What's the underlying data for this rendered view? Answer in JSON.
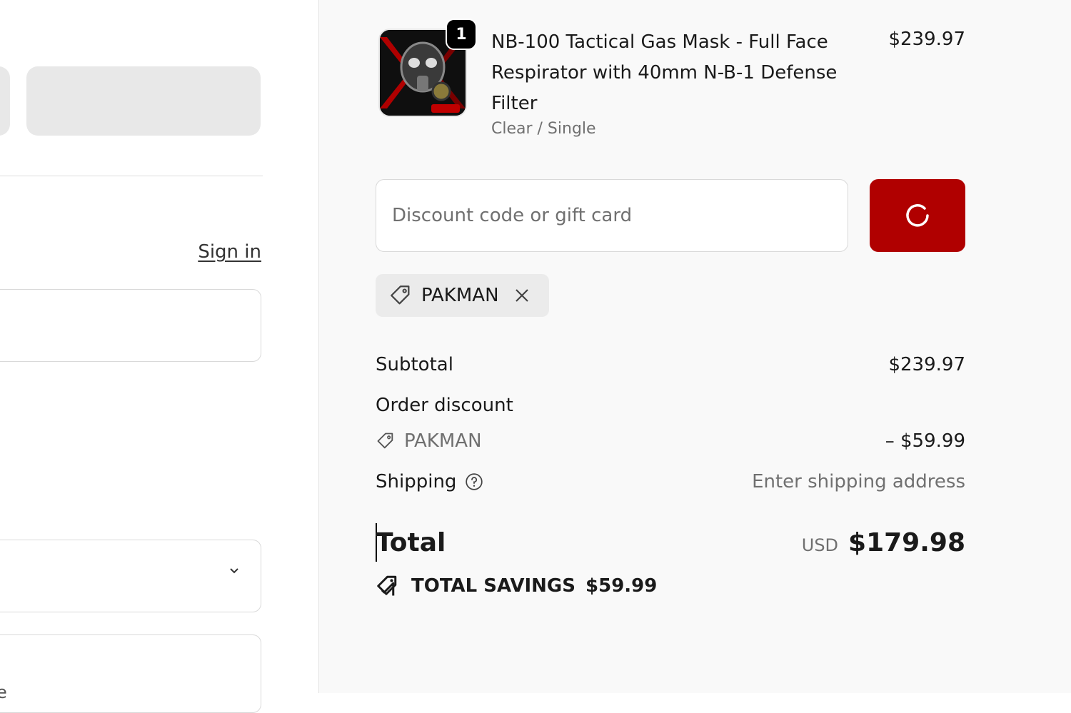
{
  "left": {
    "signin_label": "Sign in",
    "partial_field_text": "e"
  },
  "product": {
    "quantity": "1",
    "title": "NB-100 Tactical Gas Mask - Full Face Respirator with 40mm N-B-1 Defense Filter",
    "variant": "Clear / Single",
    "price": "$239.97",
    "image_icon": "gas-mask-product-image"
  },
  "discount": {
    "placeholder": "Discount code or gift card",
    "value": "",
    "apply_state": "loading",
    "applied_code": "PAKMAN"
  },
  "summary": {
    "subtotal_label": "Subtotal",
    "subtotal_value": "$239.97",
    "order_discount_label": "Order discount",
    "discount_code": "PAKMAN",
    "discount_value": "– $59.99",
    "shipping_label": "Shipping",
    "shipping_value": "Enter shipping address",
    "total_label": "Total",
    "currency": "USD",
    "total_value": "$179.98",
    "savings_label": "TOTAL SAVINGS",
    "savings_value": "$59.99"
  },
  "colors": {
    "accent": "#b00000",
    "summary_background": "#f9f9f9",
    "muted_text": "#707070"
  }
}
